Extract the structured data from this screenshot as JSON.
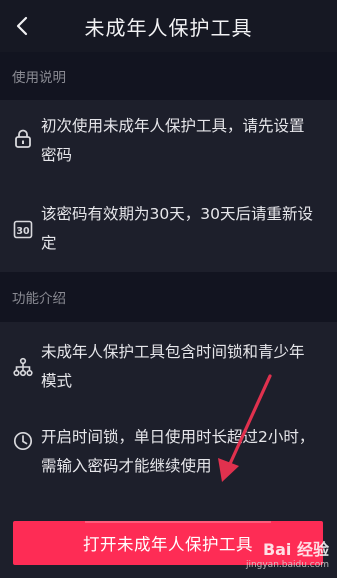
{
  "header": {
    "title": "未成年人保护工具"
  },
  "usage": {
    "heading": "使用说明",
    "items": [
      {
        "icon": "lock-icon",
        "line1": "初次使用未成年人保护工具，请先设置",
        "line2": "密码"
      },
      {
        "icon": "calendar-30-icon",
        "badge": "30",
        "line1": "该密码有效期为30天，30天后请重新设",
        "line2": "定"
      }
    ]
  },
  "features": {
    "heading": "功能介绍",
    "items": [
      {
        "icon": "hierarchy-icon",
        "line1": "未成年人保护工具包含时间锁和青少年",
        "line2": "模式"
      },
      {
        "icon": "clock-icon",
        "line1": "开启时间锁，单日使用时长超过2小时，",
        "line2": "需输入密码才能继续使用"
      }
    ]
  },
  "cta": {
    "label": "打开未成年人保护工具"
  },
  "watermark": {
    "brand": "Bai 经验",
    "url": "jingyan.baidu.com"
  },
  "colors": {
    "accent": "#fe2c55",
    "background": "#161823",
    "annotation_arrow": "#e0314e"
  }
}
